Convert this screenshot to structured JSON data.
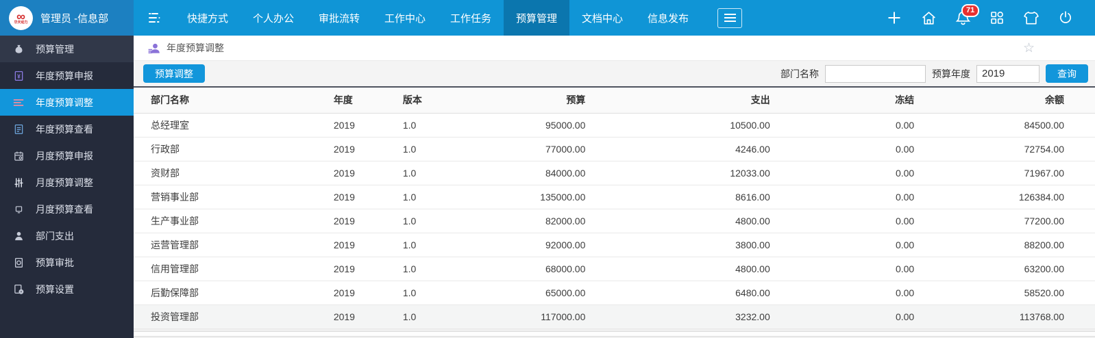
{
  "topbar": {
    "logo_symbol": "∞",
    "logo_name": "华天动力",
    "user": "管理员 -信息部",
    "nav": [
      {
        "label": "快捷方式",
        "active": false
      },
      {
        "label": "个人办公",
        "active": false
      },
      {
        "label": "审批流转",
        "active": false
      },
      {
        "label": "工作中心",
        "active": false
      },
      {
        "label": "工作任务",
        "active": false
      },
      {
        "label": "预算管理",
        "active": true
      },
      {
        "label": "文档中心",
        "active": false
      },
      {
        "label": "信息发布",
        "active": false
      }
    ],
    "right_icons": [
      "add-icon",
      "home-icon",
      "notifications-bell-icon",
      "apps-grid-icon",
      "theme-shirt-icon",
      "logout-power-icon"
    ],
    "notification_count": "71"
  },
  "sidebar": {
    "items": [
      {
        "label": "预算管理",
        "icon": "money-bag-icon",
        "group": true,
        "active": false
      },
      {
        "label": "年度预算申报",
        "icon": "doc-yen-icon",
        "group": false,
        "active": false
      },
      {
        "label": "年度预算调整",
        "icon": "adjust-lines-icon",
        "group": false,
        "active": true
      },
      {
        "label": "年度预算查看",
        "icon": "doc-view-icon",
        "group": false,
        "active": false
      },
      {
        "label": "月度预算申报",
        "icon": "calendar-icon",
        "group": false,
        "active": false
      },
      {
        "label": "月度预算调整",
        "icon": "sliders-icon",
        "group": false,
        "active": false
      },
      {
        "label": "月度预算查看",
        "icon": "monitor-icon",
        "group": false,
        "active": false
      },
      {
        "label": "部门支出",
        "icon": "person-expense-icon",
        "group": false,
        "active": false
      },
      {
        "label": "预算审批",
        "icon": "doc-approve-icon",
        "group": false,
        "active": false
      },
      {
        "label": "预算设置",
        "icon": "doc-gear-icon",
        "group": false,
        "active": false
      }
    ]
  },
  "breadcrumb": {
    "title": "年度预算调整"
  },
  "toolbar": {
    "adjust_button": "预算调整",
    "dept_label": "部门名称",
    "dept_value": "",
    "year_label": "预算年度",
    "year_value": "2019",
    "search_button": "查询"
  },
  "table": {
    "columns": [
      "部门名称",
      "年度",
      "版本",
      "预算",
      "支出",
      "冻结",
      "余额"
    ],
    "rows": [
      {
        "name": "总经理室",
        "year": "2019",
        "version": "1.0",
        "budget": "95000.00",
        "expense": "10500.00",
        "frozen": "0.00",
        "balance": "84500.00",
        "highlighted": false
      },
      {
        "name": "行政部",
        "year": "2019",
        "version": "1.0",
        "budget": "77000.00",
        "expense": "4246.00",
        "frozen": "0.00",
        "balance": "72754.00",
        "highlighted": false
      },
      {
        "name": "资财部",
        "year": "2019",
        "version": "1.0",
        "budget": "84000.00",
        "expense": "12033.00",
        "frozen": "0.00",
        "balance": "71967.00",
        "highlighted": false
      },
      {
        "name": "营销事业部",
        "year": "2019",
        "version": "1.0",
        "budget": "135000.00",
        "expense": "8616.00",
        "frozen": "0.00",
        "balance": "126384.00",
        "highlighted": false
      },
      {
        "name": "生产事业部",
        "year": "2019",
        "version": "1.0",
        "budget": "82000.00",
        "expense": "4800.00",
        "frozen": "0.00",
        "balance": "77200.00",
        "highlighted": false
      },
      {
        "name": "运营管理部",
        "year": "2019",
        "version": "1.0",
        "budget": "92000.00",
        "expense": "3800.00",
        "frozen": "0.00",
        "balance": "88200.00",
        "highlighted": false
      },
      {
        "name": "信用管理部",
        "year": "2019",
        "version": "1.0",
        "budget": "68000.00",
        "expense": "4800.00",
        "frozen": "0.00",
        "balance": "63200.00",
        "highlighted": false
      },
      {
        "name": "后勤保障部",
        "year": "2019",
        "version": "1.0",
        "budget": "65000.00",
        "expense": "6480.00",
        "frozen": "0.00",
        "balance": "58520.00",
        "highlighted": false
      },
      {
        "name": "投资管理部",
        "year": "2019",
        "version": "1.0",
        "budget": "117000.00",
        "expense": "3232.00",
        "frozen": "0.00",
        "balance": "113768.00",
        "highlighted": true
      }
    ]
  },
  "colors": {
    "accent": "#1296db",
    "topbar": "#1095d6",
    "topbar_left": "#1c80c1",
    "nav_active": "#0b76ae",
    "sidebar_bg": "#252b3b",
    "badge_red": "#e83030"
  }
}
